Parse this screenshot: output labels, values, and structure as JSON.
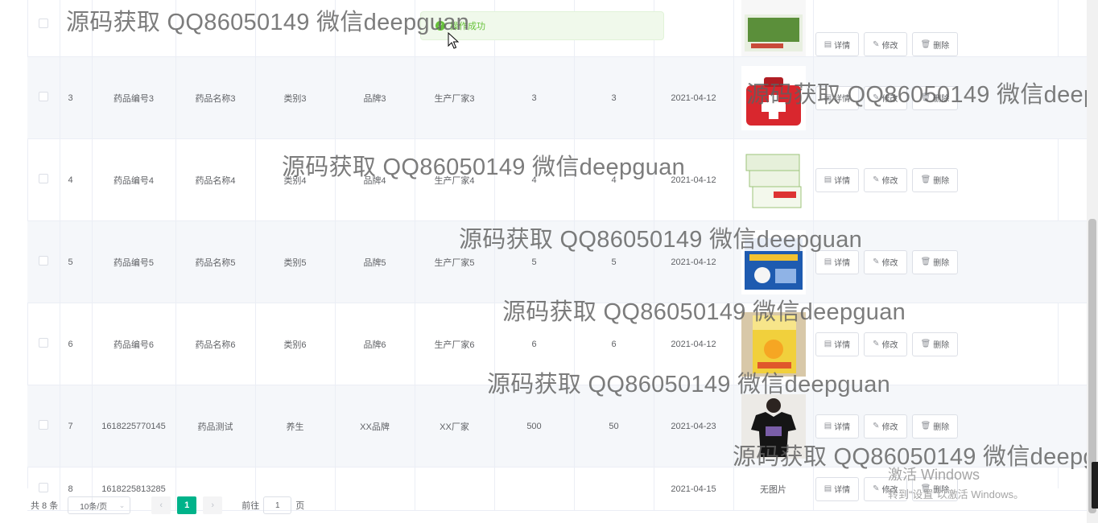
{
  "table": {
    "rows": [
      {
        "idx": "",
        "code": "",
        "name": "",
        "category": "",
        "brand": "",
        "maker": "",
        "price": "",
        "stock": "",
        "date": "",
        "image": "medicine-box-green"
      },
      {
        "idx": "3",
        "code": "药品编号3",
        "name": "药品名称3",
        "category": "类别3",
        "brand": "品牌3",
        "maker": "生产厂家3",
        "price": "3",
        "stock": "3",
        "date": "2021-04-12",
        "image": "first-aid-kit"
      },
      {
        "idx": "4",
        "code": "药品编号4",
        "name": "药品名称4",
        "category": "类别4",
        "brand": "品牌4",
        "maker": "生产厂家4",
        "price": "4",
        "stock": "4",
        "date": "2021-04-12",
        "image": "medicine-box-white"
      },
      {
        "idx": "5",
        "code": "药品编号5",
        "name": "药品名称5",
        "category": "类别5",
        "brand": "品牌5",
        "maker": "生产厂家5",
        "price": "5",
        "stock": "5",
        "date": "2021-04-12",
        "image": "medicine-box-blue"
      },
      {
        "idx": "6",
        "code": "药品编号6",
        "name": "药品名称6",
        "category": "类别6",
        "brand": "品牌6",
        "maker": "生产厂家6",
        "price": "6",
        "stock": "6",
        "date": "2021-04-12",
        "image": "medicine-box-yellow"
      },
      {
        "idx": "7",
        "code": "1618225770145",
        "name": "药品测试",
        "category": "养生",
        "brand": "XX品牌",
        "maker": "XX厂家",
        "price": "500",
        "stock": "50",
        "date": "2021-04-23",
        "image": "tshirt-photo"
      },
      {
        "idx": "8",
        "code": "1618225813285",
        "name": "",
        "category": "",
        "brand": "",
        "maker": "",
        "price": "",
        "stock": "",
        "date": "2021-04-15",
        "image": "none",
        "image_text": "无图片"
      }
    ],
    "actions": {
      "detail": "详情",
      "edit": "修改",
      "delete": "删除"
    }
  },
  "toast": {
    "text": "操作成功"
  },
  "pagination": {
    "total": "共 8 条",
    "page_size": "10条/页",
    "current": "1",
    "goto_label": "前往",
    "goto_value": "1",
    "page_suffix": "页"
  },
  "watermark": "源码获取 QQ86050149 微信deepguan",
  "activation": {
    "line1": "激活 Windows",
    "line2": "转到“设置”以激活 Windows。"
  },
  "colors": {
    "accent": "#00b38a",
    "success": "#67c23a",
    "stripe": "#f5f7fa"
  }
}
